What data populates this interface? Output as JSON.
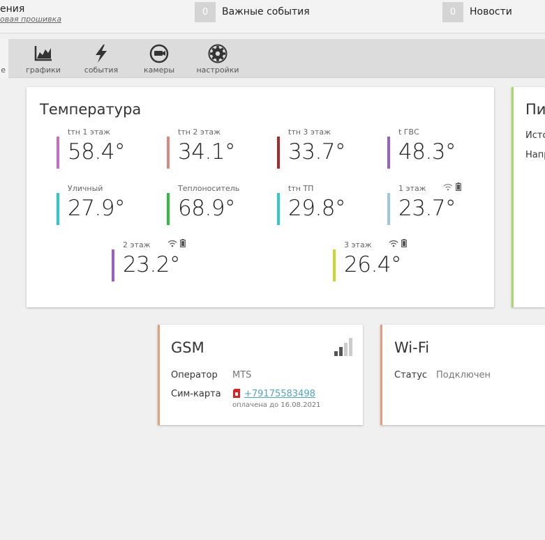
{
  "header": {
    "title": "ения",
    "subtitle": "овая прошивка",
    "important": {
      "count": "0",
      "label": "Важные события"
    },
    "news": {
      "count": "0",
      "label": "Новости"
    }
  },
  "nav": {
    "active_label": "е",
    "tabs": [
      {
        "label": "графики",
        "icon": "chart-icon"
      },
      {
        "label": "события",
        "icon": "lightning-icon"
      },
      {
        "label": "камеры",
        "icon": "camera-icon"
      },
      {
        "label": "настройки",
        "icon": "gear-icon"
      }
    ]
  },
  "temperature": {
    "title": "Температура",
    "sensors": [
      {
        "name": "tтн 1 этаж",
        "value": "58.4°",
        "color": "#c86cc8"
      },
      {
        "name": "tтн 2 этаж",
        "value": "34.1°",
        "color": "#d98a7e"
      },
      {
        "name": "tтн 3 этаж",
        "value": "33.7°",
        "color": "#a82a2a"
      },
      {
        "name": "t ГВС",
        "value": "48.3°",
        "color": "#9b5fc0"
      },
      {
        "name": "Уличный",
        "value": "27.9°",
        "color": "#2ec9cf"
      },
      {
        "name": "Теплоноситель",
        "value": "68.9°",
        "color": "#2fbf3a"
      },
      {
        "name": "tтн ТП",
        "value": "29.8°",
        "color": "#2ec9cf"
      },
      {
        "name": "1 этаж",
        "value": "23.7°",
        "color": "#9ec6dc"
      },
      {
        "name": "2 этаж",
        "value": "23.2°",
        "color": "#9b5fc0"
      },
      {
        "name": "3 этаж",
        "value": "26.4°",
        "color": "#c9d82f"
      }
    ]
  },
  "partial_card": {
    "title": "Пи",
    "row1": "Исто",
    "row2": "Напр"
  },
  "gsm": {
    "title": "GSM",
    "operator_label": "Оператор",
    "operator_value": "MTS",
    "sim_label": "Сим-карта",
    "sim_number": "+79175583498",
    "paid_until": "оплачена до 16.08.2021"
  },
  "wifi": {
    "title": "Wi-Fi",
    "status_label": "Статус",
    "status_value": "Подключен"
  },
  "colors": {
    "gsm_accent": "#e0a080",
    "partial_accent": "#a8d86a",
    "link": "#4aa7c8"
  }
}
